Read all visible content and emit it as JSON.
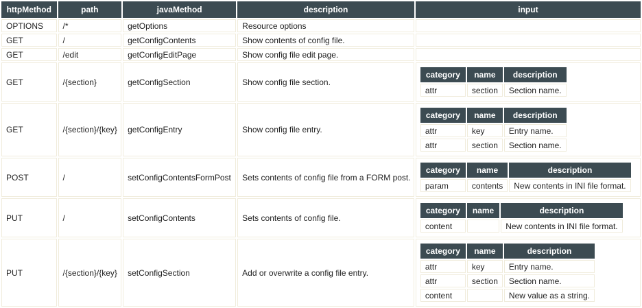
{
  "headers": [
    "httpMethod",
    "path",
    "javaMethod",
    "description",
    "input"
  ],
  "input_headers": [
    "category",
    "name",
    "description"
  ],
  "rows": [
    {
      "method": "OPTIONS",
      "path": "/*",
      "java": "getOptions",
      "desc": "Resource options",
      "inputs": []
    },
    {
      "method": "GET",
      "path": "/",
      "java": "getConfigContents",
      "desc": "Show contents of config file.",
      "inputs": []
    },
    {
      "method": "GET",
      "path": "/edit",
      "java": "getConfigEditPage",
      "desc": "Show config file edit page.",
      "inputs": []
    },
    {
      "method": "GET",
      "path": "/{section}",
      "java": "getConfigSection",
      "desc": "Show config file section.",
      "inputs": [
        [
          "attr",
          "section",
          "Section name."
        ]
      ]
    },
    {
      "method": "GET",
      "path": "/{section}/{key}",
      "java": "getConfigEntry",
      "desc": "Show config file entry.",
      "inputs": [
        [
          "attr",
          "key",
          "Entry name."
        ],
        [
          "attr",
          "section",
          "Section name."
        ]
      ]
    },
    {
      "method": "POST",
      "path": "/",
      "java": "setConfigContentsFormPost",
      "desc": "Sets contents of config file from a FORM post.",
      "inputs": [
        [
          "param",
          "contents",
          "New contents in INI file format."
        ]
      ]
    },
    {
      "method": "PUT",
      "path": "/",
      "java": "setConfigContents",
      "desc": "Sets contents of config file.",
      "inputs": [
        [
          "content",
          "",
          "New contents in INI file format."
        ]
      ]
    },
    {
      "method": "PUT",
      "path": "/{section}/{key}",
      "java": "setConfigSection",
      "desc": "Add or overwrite a config file entry.",
      "inputs": [
        [
          "attr",
          "key",
          "Entry name."
        ],
        [
          "attr",
          "section",
          "Section name."
        ],
        [
          "content",
          "",
          "New value as a string."
        ]
      ]
    }
  ]
}
